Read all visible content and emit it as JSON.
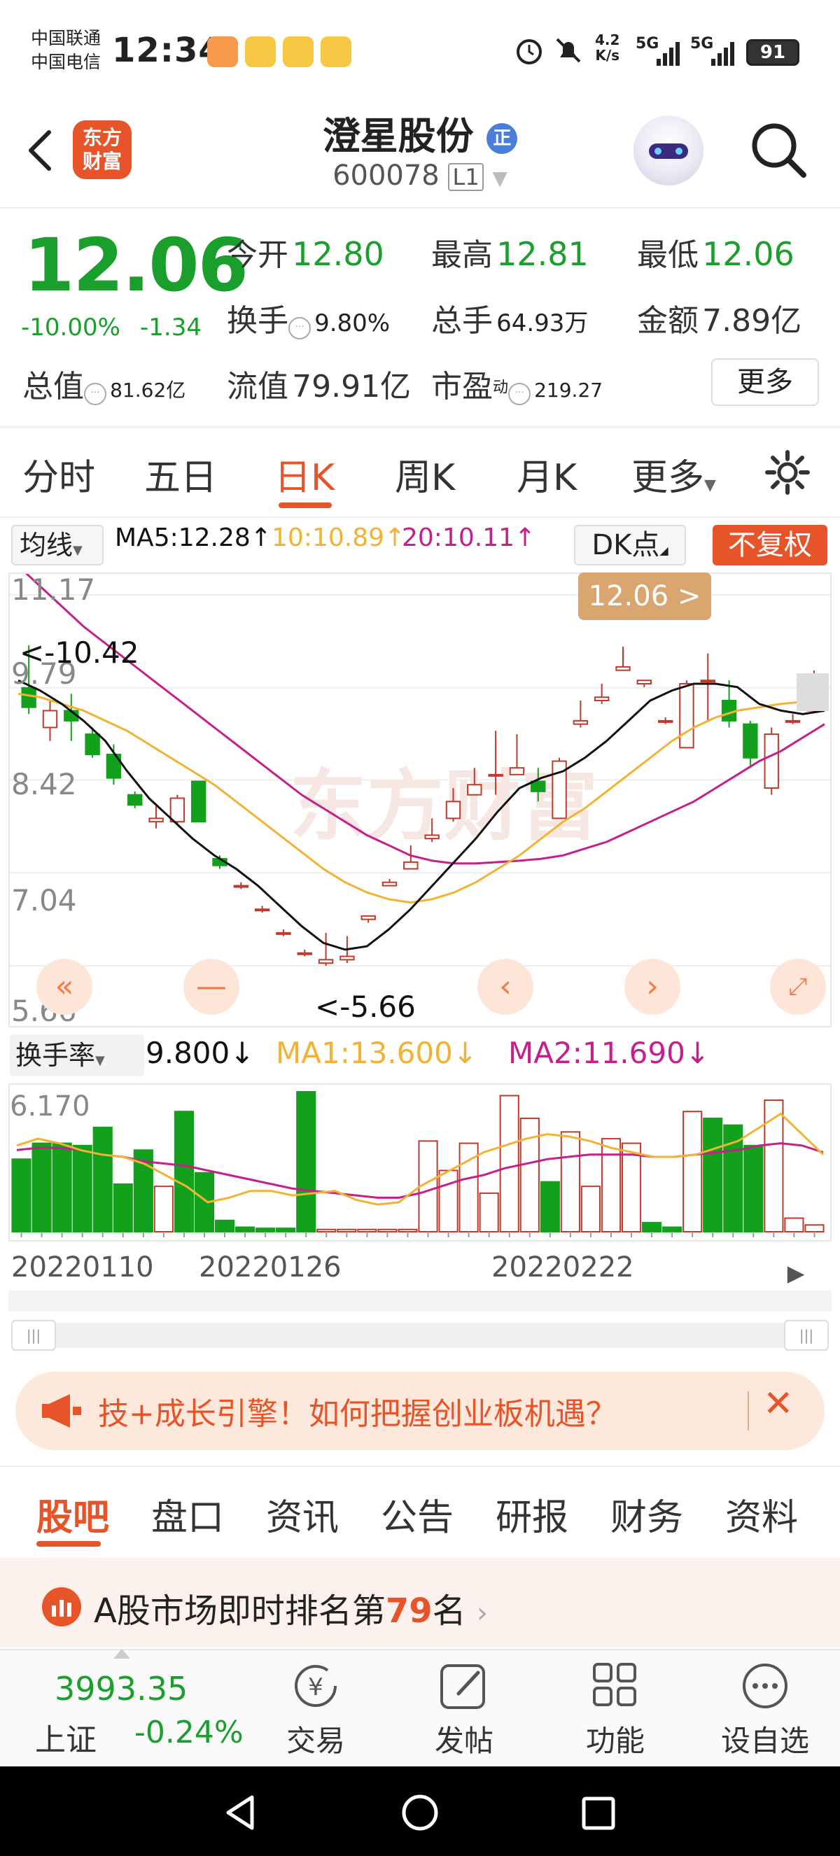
{
  "status_bar": {
    "carrier1": "中国联通",
    "carrier2": "中国电信",
    "time": "12:34",
    "net_speed_top": "4.2",
    "net_speed_bottom": "K/s",
    "signal1": "5G",
    "signal2": "5G",
    "battery": "91"
  },
  "header": {
    "logo_line1": "东方",
    "logo_line2": "财富",
    "stock_name": "澄星股份",
    "badge": "正",
    "stock_code": "600078",
    "level": "L1"
  },
  "quote": {
    "price": "12.06",
    "change_pct": "-10.00%",
    "change_abs": "-1.34",
    "open_label": "今开",
    "open": "12.80",
    "high_label": "最高",
    "high": "12.81",
    "low_label": "最低",
    "low": "12.06",
    "turnover_label": "换手",
    "turnover": "9.80%",
    "volume_label": "总手",
    "volume": "64.93万",
    "amount_label": "金额",
    "amount": "7.89亿",
    "mktcap_label": "总值",
    "mktcap": "81.62亿",
    "float_label": "流值",
    "float": "79.91亿",
    "pe_label": "市盈",
    "pe_sup": "动",
    "pe": "219.27",
    "more_button": "更多"
  },
  "chart_tabs": [
    {
      "label": "分时"
    },
    {
      "label": "五日"
    },
    {
      "label": "日K"
    },
    {
      "label": "周K"
    },
    {
      "label": "月K"
    },
    {
      "label": "更多"
    }
  ],
  "chart_toolbar": {
    "indicator": "均线",
    "ma5": "MA5:12.28↑",
    "ma10": "10:10.89↑",
    "ma20": "20:10.11↑",
    "dk": "DK点",
    "adjust": "不复权"
  },
  "kline": {
    "price_tag": "12.06 >",
    "y_labels": [
      "11.17",
      "9.79",
      "8.42",
      "7.04",
      "5.66"
    ],
    "high_note": "<-10.42",
    "low_note": "<-5.66"
  },
  "volume_toolbar": {
    "indicator": "换手率",
    "value": "9.800↓",
    "ma1": "MA1:13.600↓",
    "ma2": "MA2:11.690↓",
    "y_top": "6.170"
  },
  "dates": [
    "20220110",
    "20220126",
    "20220222"
  ],
  "colors": {
    "up": "#c0392b",
    "down": "#12a01d",
    "ma5": "#111111",
    "ma10": "#f2b233",
    "ma20": "#c51f8a",
    "accent": "#e8542a"
  },
  "chart_data": {
    "type": "candlestick",
    "ylim": [
      5.66,
      11.17
    ],
    "candles": [
      {
        "o": 9.79,
        "c": 9.5,
        "h": 10.42,
        "l": 9.4
      },
      {
        "o": 9.2,
        "c": 9.45,
        "h": 9.6,
        "l": 9.0
      },
      {
        "o": 9.45,
        "c": 9.3,
        "h": 9.7,
        "l": 9.0
      },
      {
        "o": 9.1,
        "c": 8.8,
        "h": 9.2,
        "l": 8.75
      },
      {
        "o": 8.8,
        "c": 8.45,
        "h": 8.95,
        "l": 8.35
      },
      {
        "o": 8.2,
        "c": 8.05,
        "h": 8.25,
        "l": 8.0
      },
      {
        "o": 7.8,
        "c": 7.85,
        "h": 8.05,
        "l": 7.7
      },
      {
        "o": 7.8,
        "c": 8.15,
        "h": 8.2,
        "l": 7.75
      },
      {
        "o": 8.4,
        "c": 7.8,
        "h": 8.4,
        "l": 7.8
      },
      {
        "o": 7.25,
        "c": 7.15,
        "h": 7.3,
        "l": 7.1
      },
      {
        "o": 6.85,
        "c": 6.85,
        "h": 6.9,
        "l": 6.8
      },
      {
        "o": 6.5,
        "c": 6.5,
        "h": 6.55,
        "l": 6.45
      },
      {
        "o": 6.15,
        "c": 6.15,
        "h": 6.2,
        "l": 6.1
      },
      {
        "o": 5.85,
        "c": 5.85,
        "h": 5.9,
        "l": 5.8
      },
      {
        "o": 5.7,
        "c": 5.75,
        "h": 6.15,
        "l": 5.66
      },
      {
        "o": 5.75,
        "c": 5.8,
        "h": 6.1,
        "l": 5.7
      },
      {
        "o": 6.35,
        "c": 6.4,
        "h": 6.4,
        "l": 6.3
      },
      {
        "o": 6.85,
        "c": 6.9,
        "h": 6.95,
        "l": 6.85
      },
      {
        "o": 7.1,
        "c": 7.2,
        "h": 7.45,
        "l": 7.1
      },
      {
        "o": 7.55,
        "c": 7.6,
        "h": 7.85,
        "l": 7.5
      },
      {
        "o": 7.85,
        "c": 8.1,
        "h": 8.3,
        "l": 7.8
      },
      {
        "o": 8.2,
        "c": 8.35,
        "h": 8.6,
        "l": 8.2
      },
      {
        "o": 8.5,
        "c": 8.5,
        "h": 9.15,
        "l": 8.2
      },
      {
        "o": 8.5,
        "c": 8.6,
        "h": 9.1,
        "l": 8.5
      },
      {
        "o": 8.4,
        "c": 8.25,
        "h": 8.6,
        "l": 8.1
      },
      {
        "o": 7.85,
        "c": 8.7,
        "h": 8.75,
        "l": 7.85
      },
      {
        "o": 9.25,
        "c": 9.3,
        "h": 9.6,
        "l": 9.2
      },
      {
        "o": 9.6,
        "c": 9.65,
        "h": 9.85,
        "l": 9.55
      },
      {
        "o": 10.05,
        "c": 10.1,
        "h": 10.4,
        "l": 10.05
      },
      {
        "o": 9.85,
        "c": 9.9,
        "h": 9.9,
        "l": 9.8
      },
      {
        "o": 9.3,
        "c": 9.3,
        "h": 9.35,
        "l": 9.25
      },
      {
        "o": 8.9,
        "c": 9.85,
        "h": 9.9,
        "l": 8.9
      },
      {
        "o": 9.9,
        "c": 9.9,
        "h": 10.3,
        "l": 9.3
      },
      {
        "o": 9.6,
        "c": 9.3,
        "h": 9.9,
        "l": 9.2
      },
      {
        "o": 9.25,
        "c": 8.75,
        "h": 9.3,
        "l": 8.6
      },
      {
        "o": 8.3,
        "c": 9.1,
        "h": 9.2,
        "l": 8.2
      },
      {
        "o": 9.3,
        "c": 9.3,
        "h": 9.4,
        "l": 9.25
      },
      {
        "o": 9.45,
        "c": 9.5,
        "h": 10.05,
        "l": 9.45
      }
    ],
    "ma5": [
      9.9,
      9.75,
      9.55,
      9.3,
      9.0,
      8.55,
      8.15,
      7.85,
      7.55,
      7.3,
      7.1,
      6.85,
      6.55,
      6.25,
      6.0,
      5.9,
      5.95,
      6.2,
      6.5,
      6.85,
      7.2,
      7.55,
      7.95,
      8.3,
      8.45,
      8.55,
      8.75,
      9.0,
      9.3,
      9.6,
      9.75,
      9.85,
      9.85,
      9.8,
      9.55,
      9.45,
      9.4,
      9.45
    ],
    "ma10": [
      9.7,
      9.65,
      9.55,
      9.45,
      9.3,
      9.15,
      8.95,
      8.75,
      8.55,
      8.35,
      8.1,
      7.85,
      7.6,
      7.35,
      7.1,
      6.9,
      6.75,
      6.65,
      6.6,
      6.65,
      6.75,
      6.9,
      7.1,
      7.3,
      7.55,
      7.8,
      8.0,
      8.25,
      8.5,
      8.75,
      9.0,
      9.2,
      9.35,
      9.45,
      9.5,
      9.55,
      9.58,
      9.62
    ],
    "ma20": [
      11.6,
      11.3,
      11.0,
      10.7,
      10.45,
      10.2,
      9.95,
      9.7,
      9.45,
      9.2,
      8.95,
      8.7,
      8.45,
      8.2,
      8.0,
      7.8,
      7.6,
      7.45,
      7.3,
      7.22,
      7.18,
      7.18,
      7.2,
      7.22,
      7.25,
      7.3,
      7.4,
      7.5,
      7.65,
      7.8,
      7.95,
      8.1,
      8.3,
      8.5,
      8.7,
      8.85,
      9.05,
      9.25
    ],
    "turnover": [
      {
        "v": 3.2,
        "up": false
      },
      {
        "v": 3.9,
        "up": false
      },
      {
        "v": 3.9,
        "up": false
      },
      {
        "v": 3.8,
        "up": false
      },
      {
        "v": 4.6,
        "up": false
      },
      {
        "v": 2.1,
        "up": false
      },
      {
        "v": 3.6,
        "up": false
      },
      {
        "v": 2.0,
        "up": true
      },
      {
        "v": 5.3,
        "up": false
      },
      {
        "v": 2.6,
        "up": false
      },
      {
        "v": 0.5,
        "up": false
      },
      {
        "v": 0.2,
        "up": false
      },
      {
        "v": 0.15,
        "up": false
      },
      {
        "v": 0.15,
        "up": false
      },
      {
        "v": 6.17,
        "up": false
      },
      {
        "v": 0.1,
        "up": true
      },
      {
        "v": 0.1,
        "up": true
      },
      {
        "v": 0.1,
        "up": true
      },
      {
        "v": 0.1,
        "up": true
      },
      {
        "v": 0.1,
        "up": true
      },
      {
        "v": 4.0,
        "up": true
      },
      {
        "v": 2.7,
        "up": true
      },
      {
        "v": 3.9,
        "up": true
      },
      {
        "v": 1.7,
        "up": true
      },
      {
        "v": 6.0,
        "up": true
      },
      {
        "v": 5.0,
        "up": true
      },
      {
        "v": 2.2,
        "up": false
      },
      {
        "v": 4.4,
        "up": true
      },
      {
        "v": 2.0,
        "up": true
      },
      {
        "v": 4.1,
        "up": true
      },
      {
        "v": 3.9,
        "up": true
      },
      {
        "v": 0.4,
        "up": false
      },
      {
        "v": 0.2,
        "up": false
      },
      {
        "v": 5.3,
        "up": true
      },
      {
        "v": 5.0,
        "up": false
      },
      {
        "v": 4.7,
        "up": false
      },
      {
        "v": 3.8,
        "up": false
      },
      {
        "v": 5.8,
        "up": true
      },
      {
        "v": 0.6,
        "up": true
      },
      {
        "v": 0.3,
        "up": true
      }
    ],
    "turnover_ma1": [
      3.8,
      4.1,
      3.9,
      3.6,
      3.4,
      3.3,
      3.0,
      2.5,
      2.0,
      1.3,
      1.5,
      1.8,
      1.8,
      1.6,
      1.7,
      1.8,
      1.4,
      1.2,
      1.3,
      2.0,
      2.5,
      3.0,
      3.5,
      3.8,
      4.1,
      4.3,
      4.2,
      4.0,
      3.7,
      3.5,
      3.3,
      3.3,
      3.4,
      3.7,
      4.0,
      4.6,
      5.2,
      4.3,
      3.4
    ],
    "turnover_ma2": [
      3.6,
      3.7,
      3.7,
      3.6,
      3.4,
      3.3,
      3.1,
      3.0,
      2.9,
      2.7,
      2.5,
      2.3,
      2.1,
      1.9,
      1.8,
      1.7,
      1.6,
      1.5,
      1.5,
      1.7,
      2.0,
      2.3,
      2.5,
      2.8,
      3.0,
      3.2,
      3.3,
      3.4,
      3.4,
      3.4,
      3.3,
      3.3,
      3.4,
      3.5,
      3.6,
      3.8,
      3.9,
      3.8,
      3.5
    ]
  },
  "banner": {
    "text": "技+成长引擎！如何把握创业板机遇？"
  },
  "bottom_tabs": [
    {
      "label": "股吧"
    },
    {
      "label": "盘口"
    },
    {
      "label": "资讯"
    },
    {
      "label": "公告"
    },
    {
      "label": "研报"
    },
    {
      "label": "财务"
    },
    {
      "label": "资料"
    }
  ],
  "rank": {
    "prefix": "A股市场即时排名第",
    "number": "79",
    "suffix": "名"
  },
  "bottom_nav": {
    "index_value": "3993.35",
    "index_name": "上证",
    "index_change": "-0.24%",
    "items": [
      {
        "label": "交易",
        "icon": "yen-swap-icon"
      },
      {
        "label": "发帖",
        "icon": "edit-icon"
      },
      {
        "label": "功能",
        "icon": "grid-icon"
      },
      {
        "label": "设自选",
        "icon": "more-dots-icon"
      }
    ]
  }
}
